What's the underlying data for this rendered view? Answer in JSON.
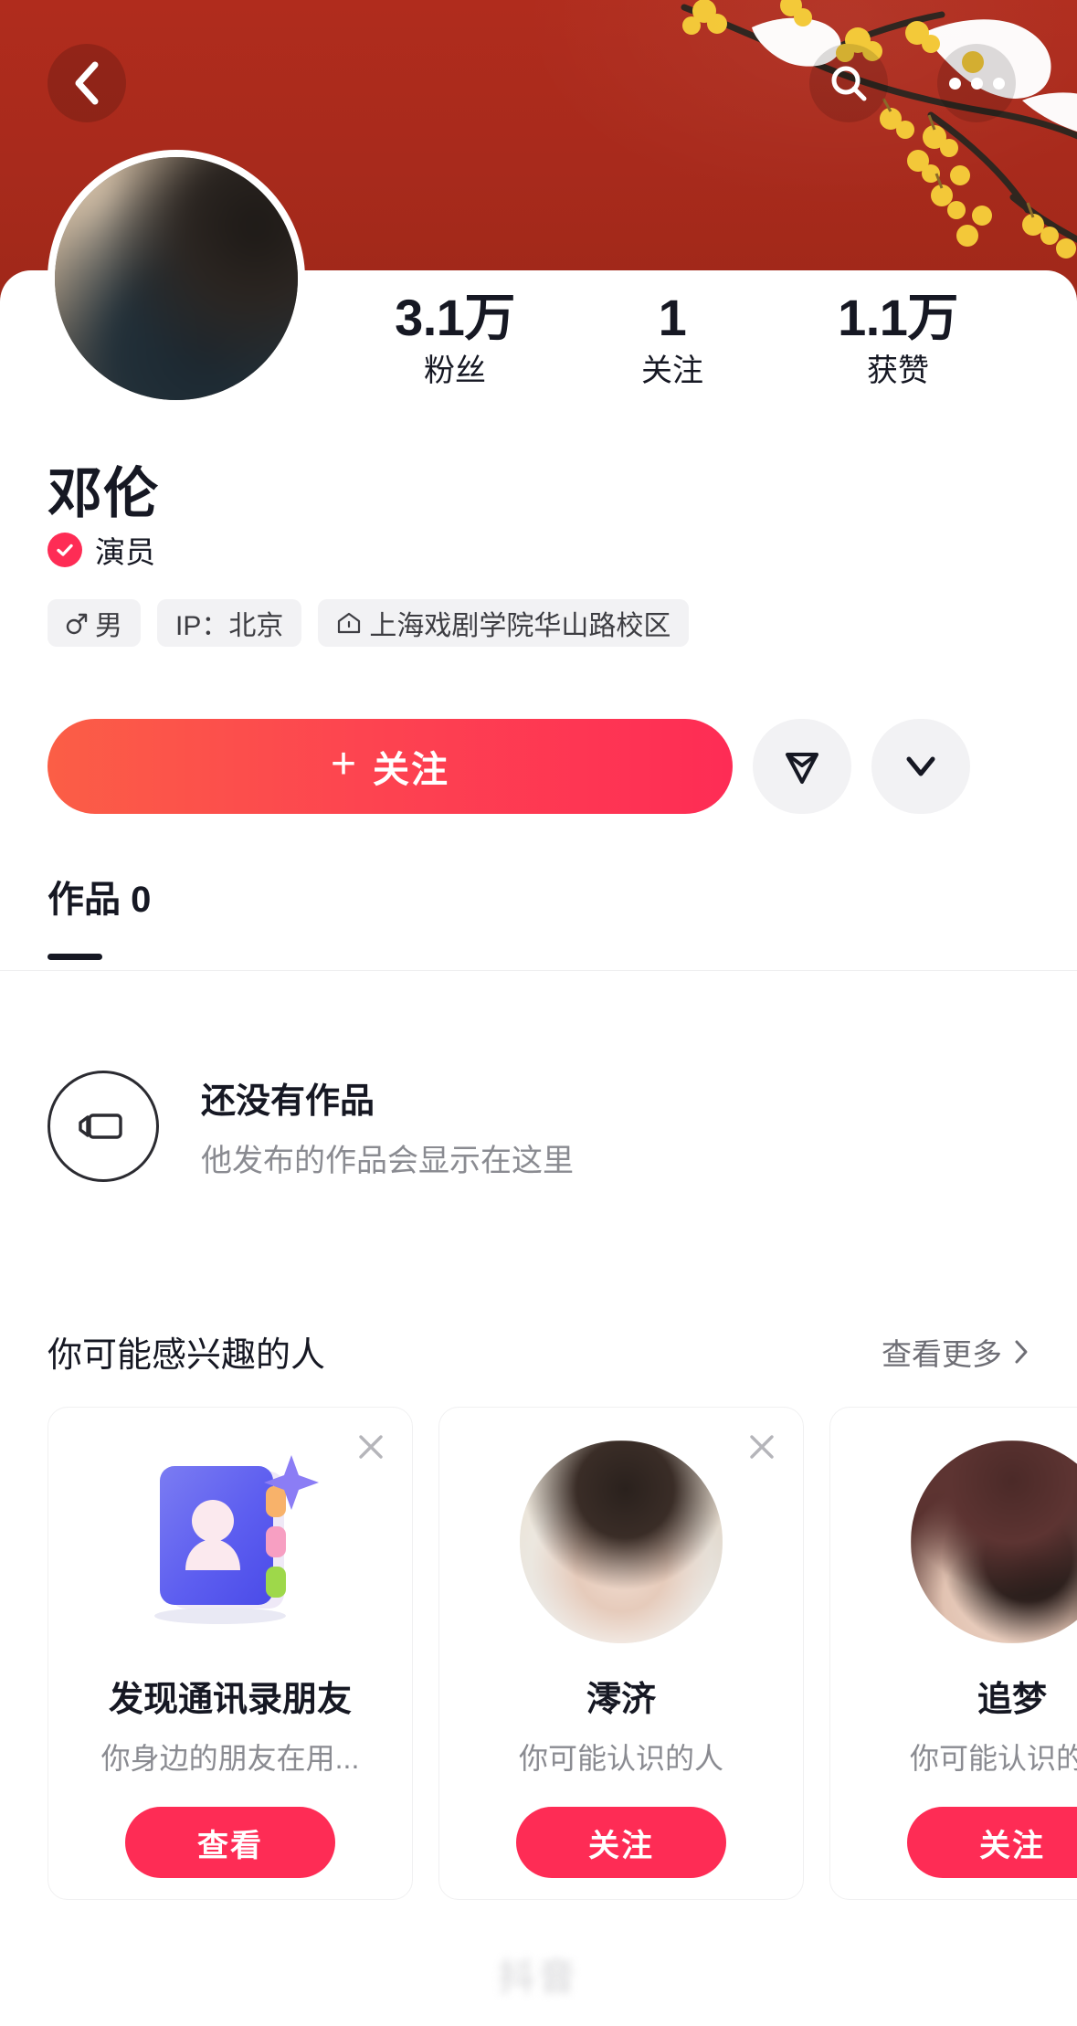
{
  "header": {
    "back_icon": "chevron-left-icon",
    "search_icon": "search-icon",
    "more_icon": "more-horizontal-icon",
    "cover_theme_color": "#ab2a1c"
  },
  "profile": {
    "avatar_alt": "user-avatar",
    "name": "邓伦",
    "verified_label": "演员",
    "verified_color": "#fe2c55",
    "stats": [
      {
        "value": "3.1万",
        "label": "粉丝"
      },
      {
        "value": "1",
        "label": "关注"
      },
      {
        "value": "1.1万",
        "label": "获赞"
      }
    ],
    "tags": [
      {
        "icon": "male-gender-icon",
        "text": "男"
      },
      {
        "icon": "none",
        "text": "IP：北京"
      },
      {
        "icon": "school-icon",
        "text": "上海戏剧学院华山路校区"
      }
    ]
  },
  "actions": {
    "follow_label": "关注",
    "follow_plus": "+",
    "follow_gradient_start": "#fb5e46",
    "follow_gradient_end": "#fe2c55",
    "share_icon": "send-plane-icon",
    "expand_icon": "chevron-down-icon"
  },
  "tabs": [
    {
      "label": "作品 0",
      "active": true
    }
  ],
  "empty_state": {
    "icon": "video-camera-icon",
    "title": "还没有作品",
    "subtitle": "他发布的作品会显示在这里"
  },
  "recommend": {
    "title": "你可能感兴趣的人",
    "more_label": "查看更多",
    "more_icon": "chevron-right-icon",
    "close_icon": "close-icon",
    "cards": [
      {
        "avatar_type": "contacts-illustration",
        "name": "发现通讯录朋友",
        "subtitle": "你身边的朋友在用...",
        "button_label": "查看"
      },
      {
        "avatar_type": "photo-female",
        "name": "澪济",
        "subtitle": "你可能认识的人",
        "button_label": "关注"
      },
      {
        "avatar_type": "photo-anime",
        "name": "追梦",
        "subtitle": "你可能认识的人",
        "button_label": "关注"
      }
    ]
  },
  "watermark": {
    "text": "抖音"
  }
}
